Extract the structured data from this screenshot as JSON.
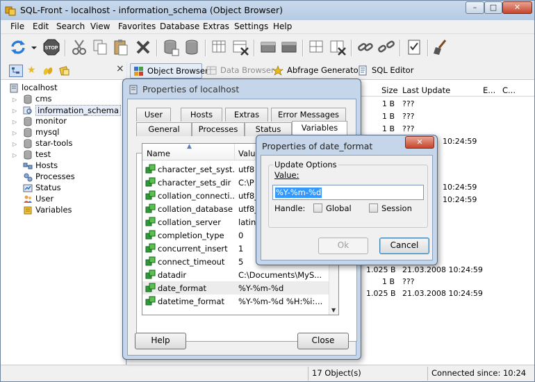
{
  "window": {
    "title": "SQL-Front - localhost - information_schema  (Object Browser)",
    "min": "–",
    "max": "□",
    "close": "✕"
  },
  "menu": [
    "File",
    "Edit",
    "Search",
    "View",
    "Favorites",
    "Database",
    "Extras",
    "Settings",
    "Help"
  ],
  "toolbar": {
    "icons": [
      "refresh-icon",
      "dropdown-arrow-icon",
      "stop-icon",
      "cut-icon",
      "copy-icon",
      "paste-icon",
      "delete-icon",
      "new-database-icon",
      "database-icon",
      "new-table-icon",
      "delete-table-icon",
      "new-row-icon",
      "edit-row-icon",
      "new-field-icon",
      "delete-field-icon",
      "link-icon",
      "unlink-icon",
      "checklist-icon",
      "clear-icon"
    ],
    "stop_label": "STOP"
  },
  "left": {
    "tool_icons": [
      "tree-view-icon",
      "favorites-star-icon",
      "bookmarks-icon",
      "history-icon"
    ],
    "close": "×",
    "tree": [
      {
        "label": "localhost",
        "icon": "server-icon"
      },
      {
        "label": "cms",
        "icon": "database-icon"
      },
      {
        "label": "information_schema",
        "icon": "database-search-icon",
        "selected": true
      },
      {
        "label": "monitor",
        "icon": "database-icon"
      },
      {
        "label": "mysql",
        "icon": "database-icon"
      },
      {
        "label": "star-tools",
        "icon": "database-icon"
      },
      {
        "label": "test",
        "icon": "database-icon"
      },
      {
        "label": "Hosts",
        "icon": "hosts-icon"
      },
      {
        "label": "Processes",
        "icon": "processes-icon"
      },
      {
        "label": "Status",
        "icon": "status-icon"
      },
      {
        "label": "User",
        "icon": "users-icon"
      },
      {
        "label": "Variables",
        "icon": "variables-icon"
      }
    ]
  },
  "views": [
    {
      "label": "Object Browser",
      "active": true
    },
    {
      "label": "Data Browser",
      "disabled": true
    },
    {
      "label": "Abfrage Generator"
    },
    {
      "label": "SQL Editor"
    }
  ],
  "list": {
    "headers": {
      "size": "Size",
      "last_update": "Last Update",
      "e": "E...",
      "c": "C..."
    },
    "rows": [
      {
        "size": "1 B",
        "date": "???"
      },
      {
        "size": "1 B",
        "date": "???"
      },
      {
        "size": "1 B",
        "date": "???"
      },
      {
        "size": "",
        "date": "10:24:59"
      },
      {
        "size": "",
        "date": "10:24:59"
      },
      {
        "size": "",
        "date": "10:24:59"
      },
      {
        "size": "1.025 B",
        "date": "21.03.2008 10:24:59"
      },
      {
        "size": "1 B",
        "date": "???"
      },
      {
        "size": "1.025 B",
        "date": "21.03.2008 10:24:59"
      }
    ]
  },
  "status": {
    "objects": "17 Object(s)",
    "connected": "Connected since: 10:24"
  },
  "props_dialog": {
    "title": "Properties of localhost",
    "tabs_row1": [
      "User",
      "Hosts",
      "Extras",
      "Error Messages"
    ],
    "tabs_row2": [
      "General",
      "Processes",
      "Status",
      "Variables"
    ],
    "columns": {
      "name": "Name",
      "value": "Value"
    },
    "vars": [
      {
        "name": "character_set_syst...",
        "value": "utf8"
      },
      {
        "name": "character_sets_dir",
        "value": "C:\\P"
      },
      {
        "name": "collation_connecti...",
        "value": "utf8_"
      },
      {
        "name": "collation_database",
        "value": "utf8_"
      },
      {
        "name": "collation_server",
        "value": "latin"
      },
      {
        "name": "completion_type",
        "value": "0"
      },
      {
        "name": "concurrent_insert",
        "value": "1"
      },
      {
        "name": "connect_timeout",
        "value": "5"
      },
      {
        "name": "datadir",
        "value": "C:\\Documents\\MyS..."
      },
      {
        "name": "date_format",
        "value": "%Y-%m-%d",
        "selected": true
      },
      {
        "name": "datetime_format",
        "value": "%Y-%m-%d %H:%i:..."
      }
    ],
    "help": "Help",
    "close": "Close"
  },
  "format_dialog": {
    "title": "Properties of date_format",
    "group": "Update Options",
    "value_label": "Value:",
    "value": "%Y-%m-%d",
    "handle_label": "Handle:",
    "global": "Global",
    "session": "Session",
    "ok": "Ok",
    "cancel": "Cancel",
    "close": "✕"
  }
}
